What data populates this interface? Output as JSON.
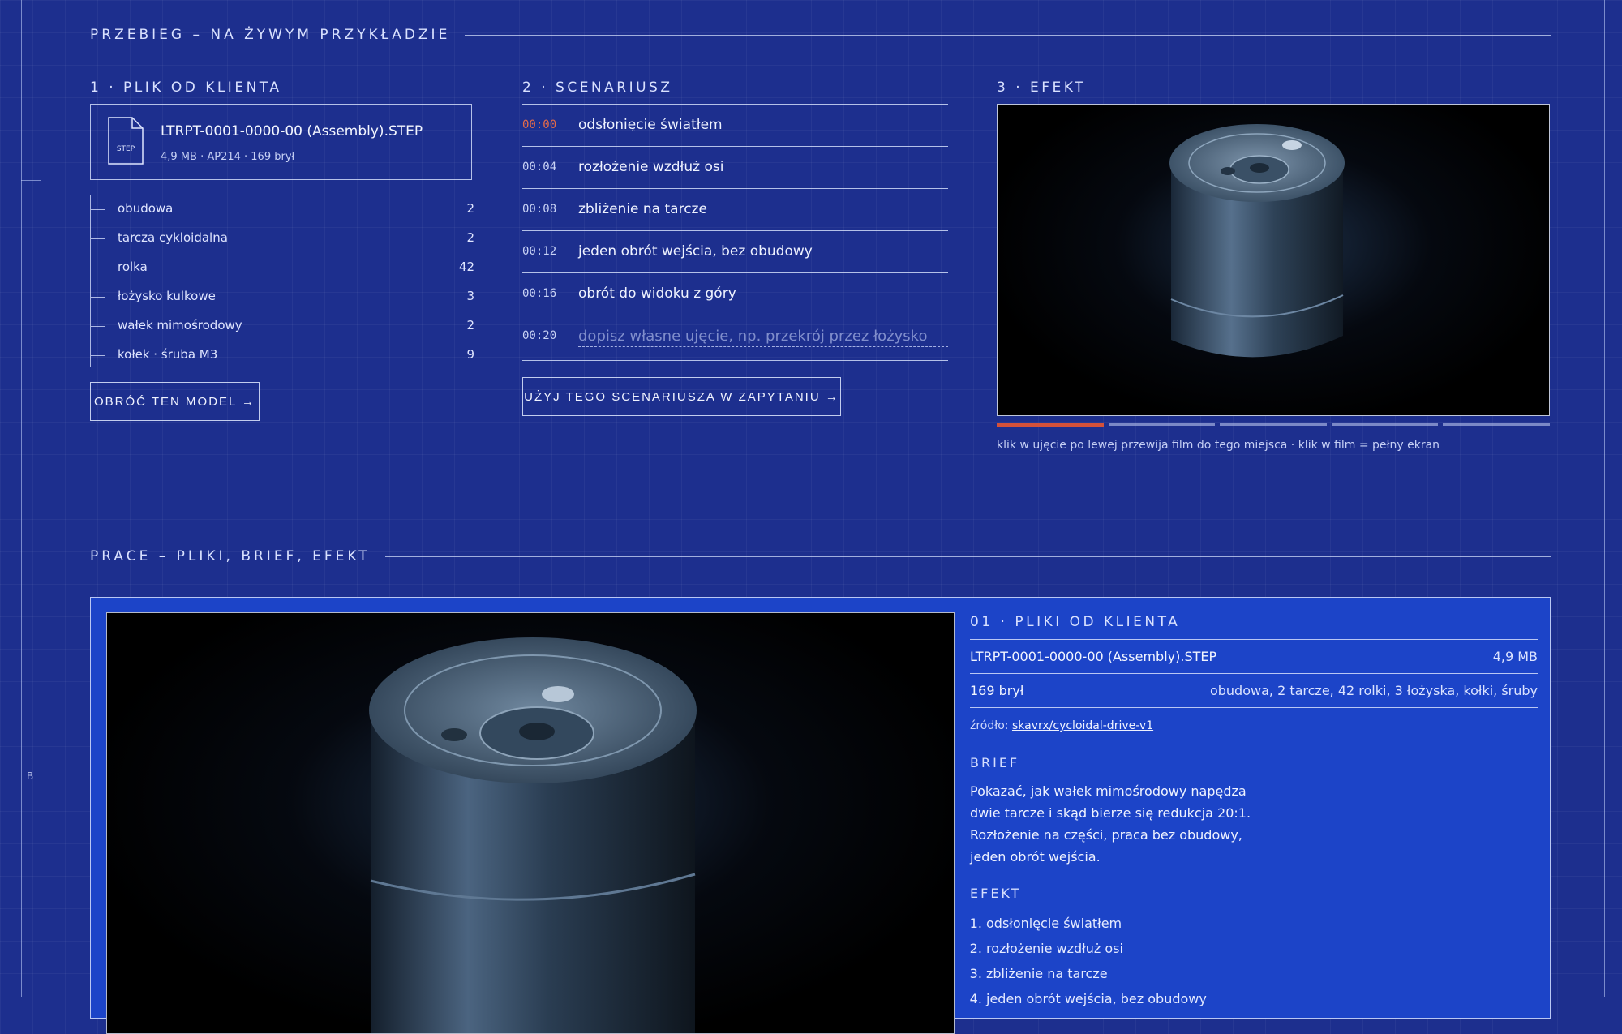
{
  "section1": {
    "title": "PRZEBIEG – NA ŻYWYM PRZYKŁADZIE"
  },
  "col1": {
    "label": "1 · PLIK OD KLIENTA",
    "file": {
      "icon_text": "STEP",
      "name": "LTRPT-0001-0000-00 (Assembly).STEP",
      "meta": "4,9 MB · AP214 · 169 brył"
    },
    "parts": [
      {
        "name": "obudowa",
        "count": "2"
      },
      {
        "name": "tarcza cykloidalna",
        "count": "2"
      },
      {
        "name": "rolka",
        "count": "42"
      },
      {
        "name": "łożysko kulkowe",
        "count": "3"
      },
      {
        "name": "wałek mimośrodowy",
        "count": "2"
      },
      {
        "name": "kołek · śruba M3",
        "count": "9"
      }
    ],
    "button": "OBRÓĆ TEN MODEL →"
  },
  "col2": {
    "label": "2 · SCENARIUSZ",
    "shots": [
      {
        "time": "00:00",
        "desc": "odsłonięcie światłem"
      },
      {
        "time": "00:04",
        "desc": "rozłożenie wzdłuż osi"
      },
      {
        "time": "00:08",
        "desc": "zbliżenie na tarcze"
      },
      {
        "time": "00:12",
        "desc": "jeden obrót wejścia, bez obudowy"
      },
      {
        "time": "00:16",
        "desc": "obrót do widoku z góry"
      }
    ],
    "input_time": "00:20",
    "input_placeholder": "dopisz własne ujęcie, np. przekrój przez łożysko",
    "button": "UŻYJ TEGO SCENARIUSZA W ZAPYTANIU →"
  },
  "col3": {
    "label": "3 · EFEKT",
    "progress": {
      "segments": 5,
      "active": 1
    },
    "hint": "klik w ujęcie po lewej przewija film do tego miejsca · klik w film = pełny ekran"
  },
  "section2": {
    "title": "PRACE – PLIKI, BRIEF, EFEKT"
  },
  "work": {
    "title": "01 · PLIKI OD KLIENTA",
    "file_name": "LTRPT-0001-0000-00 (Assembly).STEP",
    "file_size": "4,9 MB",
    "bodies": "169 brył",
    "bodies_detail": "obudowa, 2 tarcze, 42 rolki, 3 łożyska, kołki, śruby",
    "source_label": "źródło:",
    "source_link": "skavrx/cycloidal-drive-v1",
    "brief_title": "BRIEF",
    "brief_lines": [
      "Pokazać, jak wałek mimośrodowy napędza",
      "dwie tarcze i skąd bierze się redukcja 20:1.",
      "Rozłożenie na części, praca bez obudowy,",
      "jeden obrót wejścia."
    ],
    "effect_title": "EFEKT",
    "effect_items": [
      "odsłonięcie światłem",
      "rozłożenie wzdłuż osi",
      "zbliżenie na tarcze",
      "jeden obrót wejścia, bez obudowy"
    ]
  },
  "margin": {
    "letter": "B"
  },
  "colors": {
    "background": "#1d2f8e",
    "panel": "#1c44c8",
    "accent": "#d4513a"
  }
}
